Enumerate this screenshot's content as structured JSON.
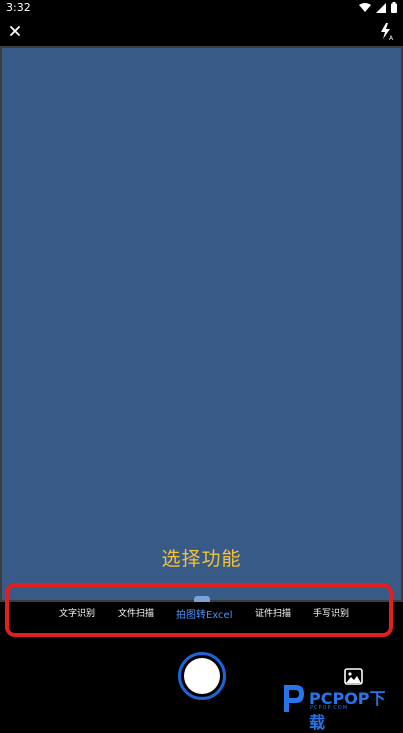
{
  "status_bar": {
    "time": "3:32",
    "icons": [
      "wifi-icon",
      "signal-icon",
      "battery-icon"
    ]
  },
  "top_bar": {
    "close_icon": "close-icon",
    "flash_icon": "flash-auto-icon"
  },
  "viewfinder": {
    "overlay_label": "选择功能"
  },
  "mode_bar": {
    "items": [
      {
        "label": "文字识别",
        "active": false
      },
      {
        "label": "文件扫描",
        "active": false
      },
      {
        "label": "拍图转Excel",
        "active": true
      },
      {
        "label": "证件扫描",
        "active": false
      },
      {
        "label": "手写识别",
        "active": false
      }
    ]
  },
  "bottom": {
    "shutter_icon": "shutter-button",
    "gallery_icon": "gallery-icon"
  },
  "watermark": {
    "brand": "PCPOP下载",
    "sub": "PCPOP.COM"
  },
  "colors": {
    "viewfinder": "#385a86",
    "overlay_label": "#f6c33a",
    "active_mode": "#4f93f7",
    "highlight": "#e21f1f",
    "shutter_ring": "#1e64d8"
  }
}
